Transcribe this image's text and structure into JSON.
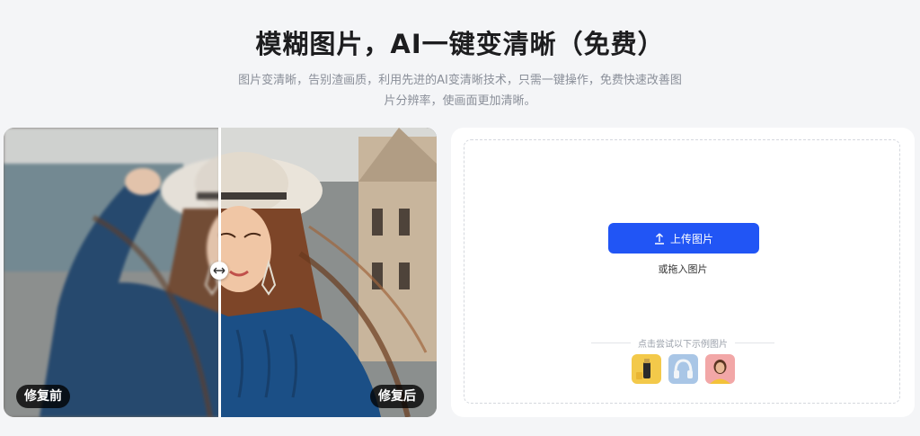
{
  "header": {
    "title": "模糊图片，AI一键变清晰（免费）",
    "subtitle": "图片变清晰，告别渣画质，利用先进的AI变清晰技术，只需一键操作，免费快速改善图片分辨率，使画面更加清晰。"
  },
  "compare": {
    "before_label": "修复前",
    "after_label": "修复后",
    "handle_icon": "left-right-arrow-icon"
  },
  "upload": {
    "button_label": "上传图片",
    "button_icon": "upload-arrow-icon",
    "drag_hint": "或拖入图片",
    "samples_caption": "点击尝试以下示例图片",
    "samples": [
      "product-bottle-sample",
      "headphones-sample",
      "portrait-sample"
    ]
  },
  "colors": {
    "accent": "#2155f5",
    "background": "#f4f5f7"
  }
}
